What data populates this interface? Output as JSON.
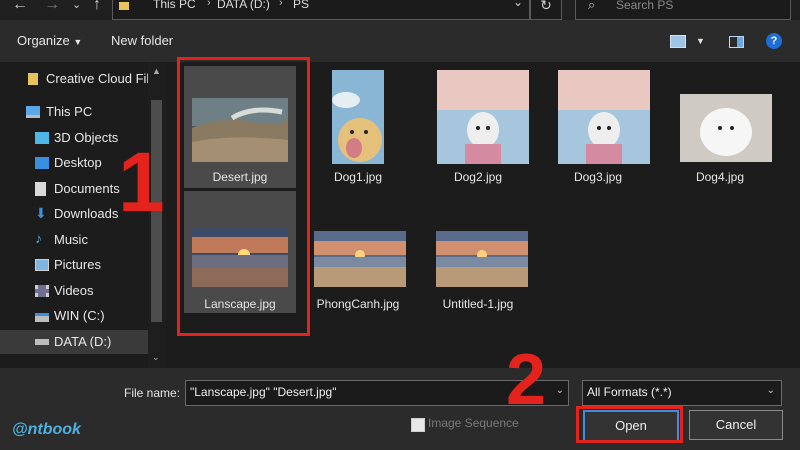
{
  "addressbar": {
    "crumbs": [
      "This PC",
      "DATA (D:)",
      "PS"
    ],
    "search_placeholder": "Search PS"
  },
  "toolbar": {
    "organize": "Organize",
    "new_folder": "New folder",
    "help": "?"
  },
  "sidebar": {
    "items": [
      {
        "label": "Creative Cloud Files",
        "icon": "creative-cloud-folder-icon"
      },
      {
        "label": "This PC",
        "icon": "computer-icon"
      },
      {
        "label": "3D Objects",
        "icon": "3d-objects-icon"
      },
      {
        "label": "Desktop",
        "icon": "desktop-icon"
      },
      {
        "label": "Documents",
        "icon": "documents-icon"
      },
      {
        "label": "Downloads",
        "icon": "downloads-icon"
      },
      {
        "label": "Music",
        "icon": "music-icon"
      },
      {
        "label": "Pictures",
        "icon": "pictures-icon"
      },
      {
        "label": "Videos",
        "icon": "videos-icon"
      },
      {
        "label": "WIN (C:)",
        "icon": "drive-icon"
      },
      {
        "label": "DATA (D:)",
        "icon": "drive-icon",
        "selected": true
      }
    ]
  },
  "files": [
    {
      "name": "Desert.jpg",
      "selected": true,
      "kind": "desert"
    },
    {
      "name": "Dog1.jpg",
      "selected": false,
      "kind": "dog-sky"
    },
    {
      "name": "Dog2.jpg",
      "selected": false,
      "kind": "dog-pink"
    },
    {
      "name": "Dog3.jpg",
      "selected": false,
      "kind": "dog-pink"
    },
    {
      "name": "Dog4.jpg",
      "selected": false,
      "kind": "dog-white"
    },
    {
      "name": "Lanscape.jpg",
      "selected": true,
      "kind": "sunset"
    },
    {
      "name": "PhongCanh.jpg",
      "selected": false,
      "kind": "beach"
    },
    {
      "name": "Untitled-1.jpg",
      "selected": false,
      "kind": "beach"
    }
  ],
  "footer": {
    "file_name_label": "File name:",
    "file_name_value": "\"Lanscape.jpg\" \"Desert.jpg\"",
    "format": "All Formats (*.*)",
    "image_sequence": "Image Sequence",
    "open": "Open",
    "cancel": "Cancel"
  },
  "annotations": {
    "step1": "1",
    "step2": "2",
    "color": "#e4231d"
  },
  "logo": "@ntbook"
}
